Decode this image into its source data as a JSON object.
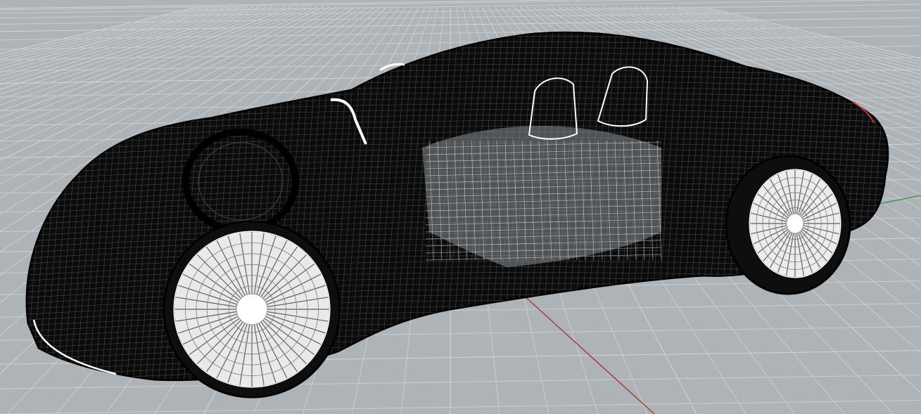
{
  "viewport": {
    "label": "",
    "background_color": "#aeb3b8",
    "grid_color": "#c9cdd1",
    "grid_major_color": "#d2d5d8",
    "x_axis_color": "#b03a3a",
    "y_axis_color": "#3f9a4a",
    "display_mode": "wireframe"
  },
  "model": {
    "object": "car-wireframe",
    "wire_color": "#0b0b0b",
    "interior_color": "#f2f2f2"
  }
}
